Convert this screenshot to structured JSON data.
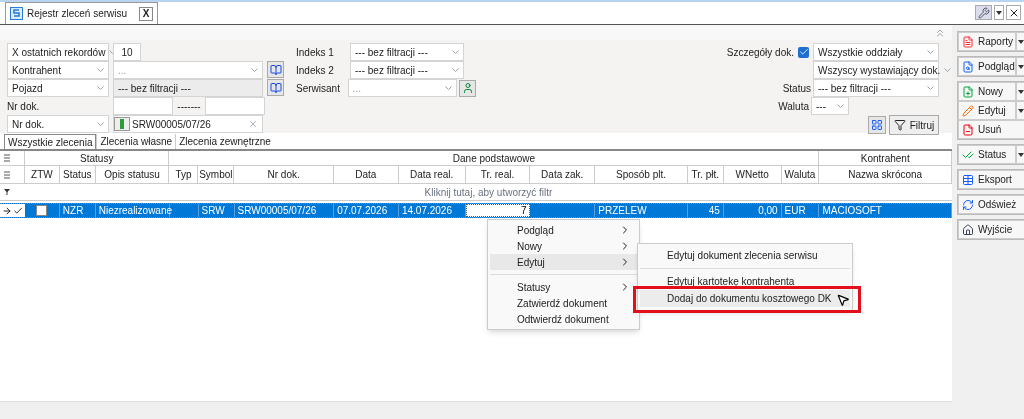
{
  "document_tab": {
    "title": "Rejestr zleceń serwisu",
    "close": "X"
  },
  "filters": {
    "left": [
      {
        "kind": "select_input",
        "select": "X ostatnich rekordów",
        "value": "10"
      },
      {
        "kind": "select_combo",
        "select": "Kontrahent",
        "placeholder": "..."
      },
      {
        "kind": "select_readonly",
        "select": "Pojazd",
        "value": "--- bez filtracji ---"
      },
      {
        "kind": "range",
        "label": "Nr dok.",
        "separator": "-------"
      },
      {
        "kind": "select_search",
        "select": "Nr dok.",
        "value": "SRW00005/07/26"
      }
    ],
    "middle": [
      {
        "label": "Indeks 1",
        "value": "--- bez filtracji ---",
        "button": false
      },
      {
        "label": "Indeks 2",
        "value": "--- bez filtracji ---",
        "button": false
      },
      {
        "label": "Serwisant",
        "placeholder": "...",
        "button": true
      }
    ],
    "details": {
      "label": "Szczegóły dok.",
      "checked": true,
      "branch": "Wszystkie oddziały",
      "issuer": "Wszyscy wystawiający dok."
    },
    "status": {
      "label": "Status",
      "value": "--- bez filtracji ---"
    },
    "currency": {
      "label": "Waluta",
      "value": "---"
    },
    "filter_button": "Filtruj"
  },
  "list_tabs": [
    {
      "label": "Wszystkie zlecenia",
      "selected": true
    },
    {
      "label": "Zlecenia własne",
      "selected": false
    },
    {
      "label": "Zlecenia zewnętrzne",
      "selected": false
    }
  ],
  "table": {
    "groups": [
      "Statusy",
      "Dane podstawowe",
      "Kontrahent"
    ],
    "columns": [
      "ZTW",
      "Status",
      "Opis statusu",
      "Typ",
      "Symbol",
      "Nr dok.",
      "Data",
      "Data real.",
      "Tr. real.",
      "Data zak.",
      "Sposób plt.",
      "Tr. płt.",
      "WNetto",
      "Waluta",
      "Nazwa skrócona"
    ],
    "filter_hint": "Kliknij tutaj, aby utworzyć filtr",
    "rows": [
      {
        "selected": true,
        "ztw_checked": false,
        "cells": [
          {
            "focused": false
          },
          {
            "text": "NZR",
            "focused": false
          },
          {
            "text": "Niezrealizowane",
            "focused": false
          },
          {
            "focused": false
          },
          {
            "text": "SRW",
            "focused": false
          },
          {
            "text": "SRW00005/07/26",
            "focused": false
          },
          {
            "text": "07.07.2026",
            "focused": false
          },
          {
            "text": "14.07.2026",
            "focused": false
          },
          {
            "text": "7",
            "focused": true
          },
          {
            "focused": false
          },
          {
            "text": "PRZELEW",
            "focused": false
          },
          {
            "text": "45",
            "focused": false
          },
          {
            "text": "0,00",
            "focused": false
          },
          {
            "text": "EUR",
            "focused": false
          },
          {
            "text": "MACIOSOFT",
            "focused": false
          }
        ]
      }
    ]
  },
  "context_menu": [
    {
      "kind": "item",
      "label": "Podgląd",
      "submenu": true,
      "selected": false
    },
    {
      "kind": "item",
      "label": "Nowy",
      "submenu": true,
      "selected": false
    },
    {
      "kind": "item",
      "label": "Edytuj",
      "submenu": true,
      "selected": true
    },
    {
      "kind": "separator"
    },
    {
      "kind": "item",
      "label": "Statusy",
      "submenu": true,
      "selected": false
    },
    {
      "kind": "item",
      "label": "Zatwierdź dokument",
      "submenu": false,
      "selected": false
    },
    {
      "kind": "item",
      "label": "Odtwierdź dokument",
      "submenu": false,
      "selected": false
    }
  ],
  "submenu": [
    {
      "kind": "item",
      "label": "Edytuj dokument zlecenia serwisu",
      "selected": false,
      "annotated": false
    },
    {
      "kind": "separator"
    },
    {
      "kind": "item",
      "label": "Edytuj kartotekę kontrahenta",
      "selected": false,
      "annotated": false
    },
    {
      "kind": "item",
      "label": "Dodaj do dokumentu kosztowego DK",
      "selected": true,
      "annotated": true
    }
  ],
  "action_groups": [
    [
      {
        "label": "Raporty",
        "dropdown": true
      }
    ],
    [
      {
        "label": "Podgląd",
        "dropdown": true
      }
    ],
    [
      {
        "label": "Nowy",
        "dropdown": true
      },
      {
        "label": "Edytuj",
        "dropdown": true
      },
      {
        "label": "Usuń",
        "dropdown": false
      }
    ],
    [
      {
        "label": "Status",
        "dropdown": true
      }
    ],
    [
      {
        "label": "Eksport",
        "dropdown": false
      }
    ],
    [
      {
        "label": "Odśwież",
        "dropdown": false
      }
    ],
    [
      {
        "label": "Wyjście",
        "dropdown": false
      }
    ]
  ]
}
